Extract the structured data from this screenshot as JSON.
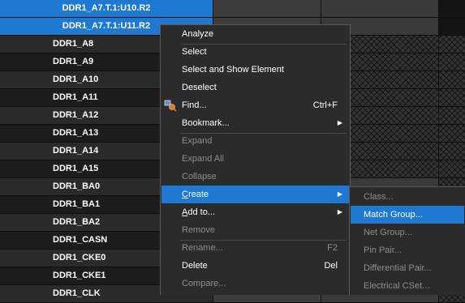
{
  "nets": [
    {
      "name": "DDR1_A7.T.1:U10.R2",
      "selected": true
    },
    {
      "name": "DDR1_A7.T.1:U11.R2",
      "selected": true
    },
    {
      "name": "DDR1_A8",
      "selected": false
    },
    {
      "name": "DDR1_A9",
      "selected": false
    },
    {
      "name": "DDR1_A10",
      "selected": false
    },
    {
      "name": "DDR1_A11",
      "selected": false
    },
    {
      "name": "DDR1_A12",
      "selected": false
    },
    {
      "name": "DDR1_A13",
      "selected": false
    },
    {
      "name": "DDR1_A14",
      "selected": false
    },
    {
      "name": "DDR1_A15",
      "selected": false
    },
    {
      "name": "DDR1_BA0",
      "selected": false
    },
    {
      "name": "DDR1_BA1",
      "selected": false
    },
    {
      "name": "DDR1_BA2",
      "selected": false
    },
    {
      "name": "DDR1_CASN",
      "selected": false
    },
    {
      "name": "DDR1_CKE0",
      "selected": false
    },
    {
      "name": "DDR1_CKE1",
      "selected": false
    },
    {
      "name": "DDR1_CLK",
      "selected": false
    }
  ],
  "context_menu": {
    "items": [
      {
        "label": "Analyze",
        "enabled": true
      },
      {
        "separator": true
      },
      {
        "label": "Select",
        "enabled": true
      },
      {
        "label": "Select and Show Element",
        "enabled": true
      },
      {
        "label": "Deselect",
        "enabled": true
      },
      {
        "label": "Find...",
        "shortcut": "Ctrl+F",
        "enabled": true,
        "icon": "find-icon"
      },
      {
        "label": "Bookmark...",
        "enabled": true,
        "submenu": true
      },
      {
        "separator": true
      },
      {
        "label": "Expand",
        "enabled": false
      },
      {
        "label": "Expand All",
        "enabled": false
      },
      {
        "label": "Collapse",
        "enabled": false
      },
      {
        "separator": true
      },
      {
        "label": "Create",
        "enabled": true,
        "submenu": true,
        "highlighted": true
      },
      {
        "label": "Add to...",
        "enabled": true,
        "submenu": true
      },
      {
        "label": "Remove",
        "enabled": false
      },
      {
        "separator": true
      },
      {
        "label": "Rename...",
        "shortcut": "F2",
        "enabled": false
      },
      {
        "label": "Delete",
        "shortcut": "Del",
        "enabled": true
      },
      {
        "label": "Compare...",
        "enabled": false
      }
    ]
  },
  "create_submenu": {
    "items": [
      {
        "label": "Class...",
        "enabled": false
      },
      {
        "label": "Match Group...",
        "enabled": true,
        "highlighted": true
      },
      {
        "label": "Net Group...",
        "enabled": false
      },
      {
        "label": "Pin Pair...",
        "enabled": false
      },
      {
        "label": "Differential Pair...",
        "enabled": false
      },
      {
        "label": "Electrical CSet...",
        "enabled": false
      }
    ]
  },
  "colors": {
    "selection": "#1f79d0",
    "menu_bg": "#2b2b2b",
    "disabled_text": "#8d8d8d"
  }
}
